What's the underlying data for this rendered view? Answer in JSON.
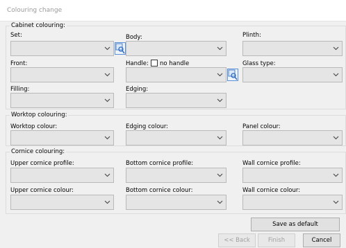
{
  "window": {
    "title": "Colouring change"
  },
  "cabinet": {
    "title": "Cabinet colouring:",
    "set_label": "Set:",
    "body_label": "Body:",
    "plinth_label": "Plinth:",
    "front_label": "Front:",
    "handle_label": "Handle:",
    "no_handle_label": "no handle",
    "no_handle_checked": false,
    "glass_label": "Glass type:",
    "filling_label": "Filling:",
    "edging_label": "Edging:"
  },
  "worktop": {
    "title": "Worktop colouring:",
    "worktop_colour_label": "Worktop colour:",
    "edging_colour_label": "Edging colour:",
    "panel_colour_label": "Panel colour:"
  },
  "cornice": {
    "title": "Cornice colouring:",
    "upper_profile_label": "Upper cornice profile:",
    "bottom_profile_label": "Bottom cornice profile:",
    "wall_profile_label": "Wall cornice profile:",
    "upper_colour_label": "Upper cornice colour:",
    "bottom_colour_label": "Bottom cornice colour:",
    "wall_colour_label": "Wall cornice colour:"
  },
  "buttons": {
    "save_default": "Save as default",
    "back": "<< Back",
    "finish": "Finish",
    "cancel": "Cancel"
  },
  "icons": {
    "dropdown": "chevron-down-icon",
    "picker": "color-picker-icon"
  }
}
